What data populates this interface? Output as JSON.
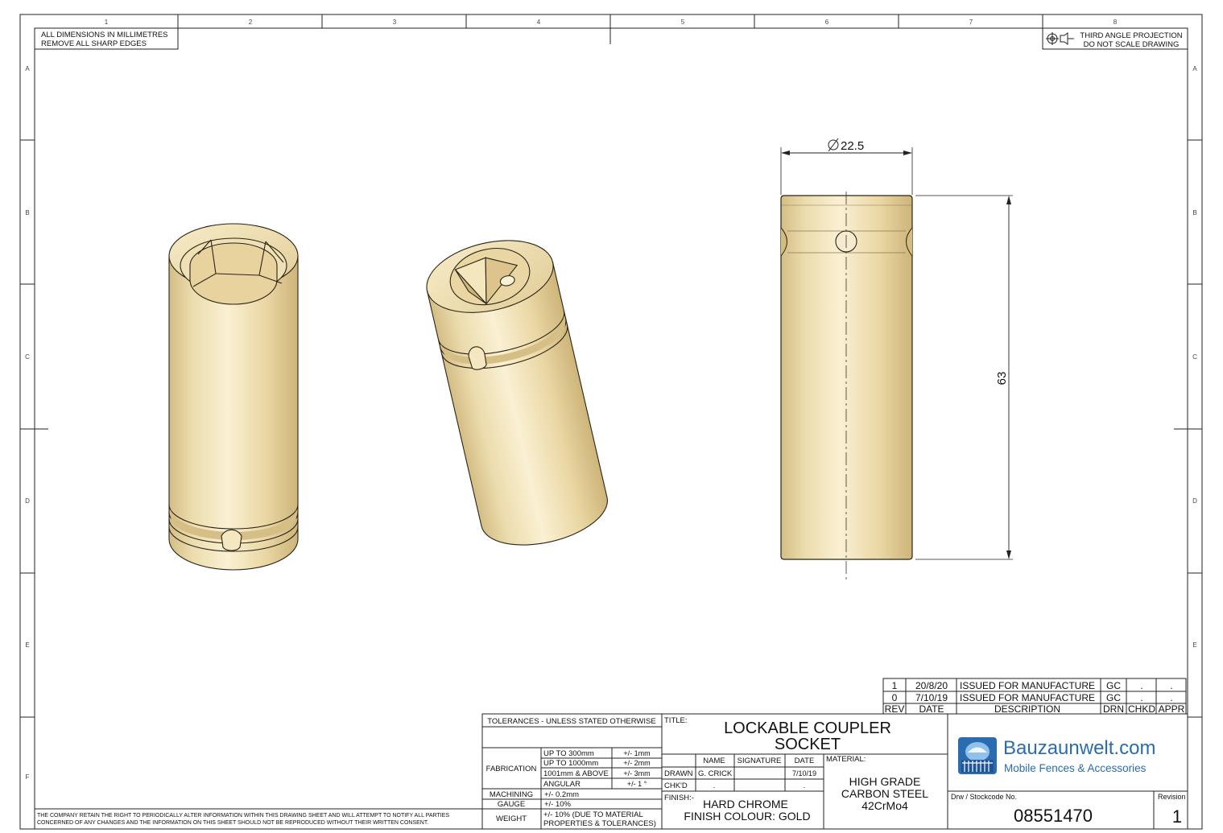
{
  "notes": {
    "dims_line1": "ALL DIMENSIONS IN MILLIMETRES",
    "dims_line2": "REMOVE ALL SHARP EDGES",
    "projection_line1": "THIRD ANGLE PROJECTION",
    "projection_line2": "DO NOT SCALE DRAWING",
    "disclaimer_line1": "THE COMPANY RETAIN THE RIGHT TO PERIODICALLY ALTER INFORMATION WITHIN THIS DRAWING SHEET AND WILL ATTEMPT TO NOTIFY ALL PARTIES",
    "disclaimer_line2": "CONCERNED OF ANY CHANGES AND THE INFORMATION ON THIS SHEET SHOULD NOT BE REPRODUCED WITHOUT THEIR WRITTEN CONSENT."
  },
  "zones": {
    "columns": [
      "1",
      "2",
      "3",
      "4",
      "5",
      "6",
      "7",
      "8"
    ],
    "rows": [
      "A",
      "B",
      "C",
      "D",
      "E",
      "F"
    ]
  },
  "dimensions": {
    "diameter": "22.5",
    "length": "63"
  },
  "revisions": {
    "rows": [
      {
        "rev": "1",
        "date": "20/8/20",
        "description": "ISSUED FOR MANUFACTURE",
        "drn": "GC",
        "chkd": ".",
        "appr": "."
      },
      {
        "rev": "0",
        "date": "7/10/19",
        "description": "ISSUED FOR MANUFACTURE",
        "drn": "GC",
        "chkd": ".",
        "appr": "."
      }
    ],
    "headers": {
      "rev": "REV",
      "date": "DATE",
      "description": "DESCRIPTION",
      "drn": "DRN",
      "chkd": "CHKD",
      "appr": "APPR"
    }
  },
  "tolerances": {
    "heading": "TOLERANCES - UNLESS STATED OTHERWISE",
    "fabrication_label": "FABRICATION",
    "fabrication": [
      {
        "range": "UP TO 300mm",
        "tol": "+/- 1mm"
      },
      {
        "range": "UP TO 1000mm",
        "tol": "+/- 2mm"
      },
      {
        "range": "1001mm & ABOVE",
        "tol": "+/- 3mm"
      },
      {
        "range": "ANGULAR",
        "tol": "+/- 1 °"
      }
    ],
    "machining_label": "MACHINING",
    "machining_value": "+/- 0.2mm",
    "gauge_label": "GAUGE",
    "gauge_value": "+/- 10%",
    "weight_label": "WEIGHT",
    "weight_line1": "+/- 10% (DUE TO MATERIAL",
    "weight_line2": "PROPERTIES & TOLERANCES)"
  },
  "title_block": {
    "title_label": "TITLE:",
    "title_line1": "LOCKABLE COUPLER",
    "title_line2": "SOCKET",
    "name_header": "NAME",
    "signature_header": "SIGNATURE",
    "date_header": "DATE",
    "drawn_label": "DRAWN",
    "drawn_name": "G. CRICK",
    "drawn_date": "7/10/19",
    "chkd_label": "CHK'D",
    "chkd_name": ".",
    "chkd_date": ".",
    "finish_label": "FINISH:-",
    "finish_line1": "HARD CHROME",
    "finish_line2": "FINISH COLOUR: GOLD",
    "material_label": "MATERIAL:",
    "material_line1": "HIGH GRADE",
    "material_line2": "CARBON STEEL",
    "material_line3": "42CrMo4",
    "stockcode_label": "Drw / Stockcode No.",
    "stockcode": "08551470",
    "revision_label": "Revision",
    "revision": "1"
  },
  "logo": {
    "brand": "Bauzaunwelt.com",
    "tagline": "Mobile Fences & Accessories",
    "color": "#2a6cb0"
  },
  "colors": {
    "body_gold": "#ead8a6",
    "body_highlight": "#fbf2d6",
    "body_shadow": "#c6ad73"
  }
}
